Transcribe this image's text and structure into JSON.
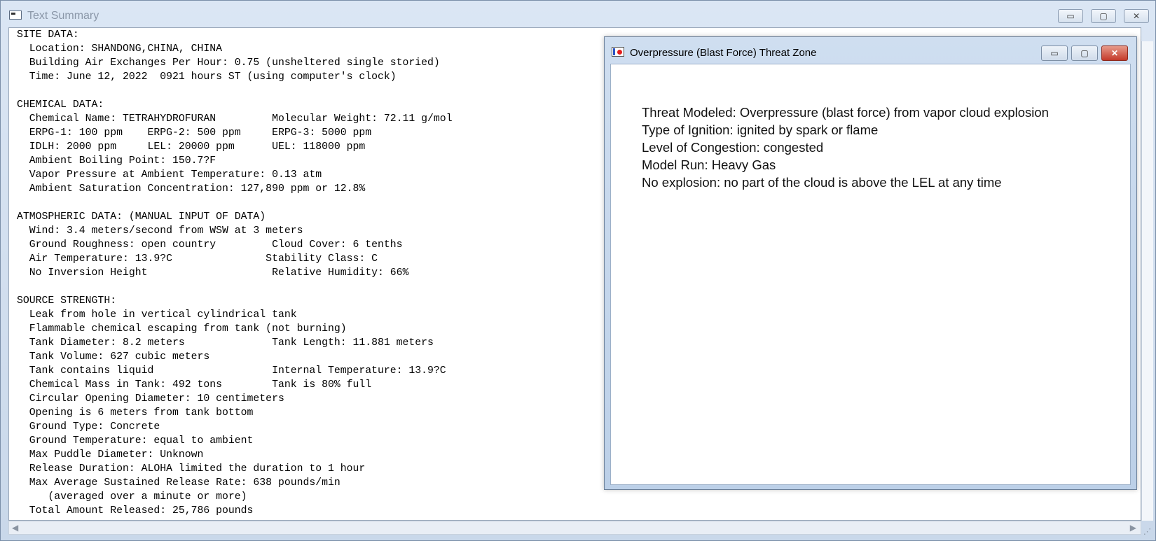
{
  "main_window": {
    "title": "Text Summary",
    "minimize": "▭",
    "maximize": "▢",
    "close": "✕"
  },
  "report_lines": [
    "SITE DATA:",
    "  Location: SHANDONG,CHINA, CHINA",
    "  Building Air Exchanges Per Hour: 0.75 (unsheltered single storied)",
    "  Time: June 12, 2022  0921 hours ST (using computer's clock)",
    "",
    "CHEMICAL DATA:",
    "  Chemical Name: TETRAHYDROFURAN         Molecular Weight: 72.11 g/mol",
    "  ERPG-1: 100 ppm    ERPG-2: 500 ppm     ERPG-3: 5000 ppm",
    "  IDLH: 2000 ppm     LEL: 20000 ppm      UEL: 118000 ppm",
    "  Ambient Boiling Point: 150.7?F",
    "  Vapor Pressure at Ambient Temperature: 0.13 atm",
    "  Ambient Saturation Concentration: 127,890 ppm or 12.8%",
    "",
    "ATMOSPHERIC DATA: (MANUAL INPUT OF DATA)",
    "  Wind: 3.4 meters/second from WSW at 3 meters",
    "  Ground Roughness: open country         Cloud Cover: 6 tenths",
    "  Air Temperature: 13.9?C               Stability Class: C",
    "  No Inversion Height                    Relative Humidity: 66%",
    "",
    "SOURCE STRENGTH:",
    "  Leak from hole in vertical cylindrical tank",
    "  Flammable chemical escaping from tank (not burning)",
    "  Tank Diameter: 8.2 meters              Tank Length: 11.881 meters",
    "  Tank Volume: 627 cubic meters",
    "  Tank contains liquid                   Internal Temperature: 13.9?C",
    "  Chemical Mass in Tank: 492 tons        Tank is 80% full",
    "  Circular Opening Diameter: 10 centimeters",
    "  Opening is 6 meters from tank bottom",
    "  Ground Type: Concrete",
    "  Ground Temperature: equal to ambient",
    "  Max Puddle Diameter: Unknown",
    "  Release Duration: ALOHA limited the duration to 1 hour",
    "  Max Average Sustained Release Rate: 638 pounds/min",
    "     (averaged over a minute or more)",
    "  Total Amount Released: 25,786 pounds"
  ],
  "threat_window": {
    "title": "Overpressure (Blast Force) Threat Zone",
    "lines": [
      "Threat Modeled: Overpressure (blast force) from vapor cloud explosion",
      "Type of Ignition: ignited by spark or flame",
      "Level of Congestion: congested",
      "Model Run: Heavy Gas",
      "No explosion: no part of the cloud is above the LEL at any time"
    ],
    "minimize": "▭",
    "maximize": "▢",
    "close": "✕"
  },
  "scrollbar": {
    "left_arrow": "◀",
    "right_arrow": "▶",
    "grip": "⋰"
  }
}
